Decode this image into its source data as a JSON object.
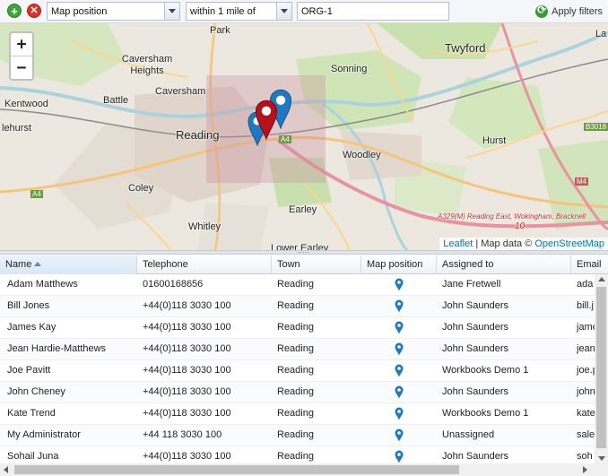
{
  "filter_bar": {
    "field_value": "Map position",
    "operator_value": "within 1 mile of",
    "target_value": "ORG-1",
    "apply_label": "Apply filters"
  },
  "map": {
    "zoom_in": "+",
    "zoom_out": "−",
    "labels": {
      "park": "Park",
      "caversham_heights": "Caversham Heights",
      "caversham": "Caversham",
      "battle": "Battle",
      "kentwood": "Kentwood",
      "tilehurst": "lehurst",
      "reading": "Reading",
      "coley": "Coley",
      "whitley": "Whitley",
      "earley": "Earley",
      "lower_earley": "Lower Earley",
      "sonning": "Sonning",
      "twyford": "Twyford",
      "woodley": "Woodley",
      "hurst": "Hurst",
      "a329m": "A329(M) Reading East, Wokingham, Bracknell",
      "junction_10": "10",
      "a4_centre": "A4",
      "a4_west": "A4",
      "m4": "M4",
      "b3018": "B3018",
      "la": "La"
    },
    "attribution_leaflet": "Leaflet",
    "attribution_sep": " | Map data © ",
    "attribution_osm": "OpenStreetMap",
    "colors": {
      "pin_blue": "#1e78c2",
      "pin_red": "#b5131c"
    }
  },
  "grid": {
    "columns": [
      "Name",
      "Telephone",
      "Town",
      "Map position",
      "Assigned to",
      "Email"
    ],
    "sorted_column": "Name",
    "rows": [
      {
        "name": "Adam Matthews",
        "telephone": "01600168656",
        "town": "Reading",
        "map_icon": "map-pin-icon",
        "assigned_to": "Jane Fretwell",
        "email": "ada"
      },
      {
        "name": "Bill Jones",
        "telephone": "+44(0)118 3030 100",
        "town": "Reading",
        "map_icon": "map-pin-icon",
        "assigned_to": "John Saunders",
        "email": "bill.j"
      },
      {
        "name": "James Kay",
        "telephone": "+44(0)118 3030 100",
        "town": "Reading",
        "map_icon": "map-pin-icon",
        "assigned_to": "John Saunders",
        "email": "jame"
      },
      {
        "name": "Jean Hardie-Matthews",
        "telephone": "+44(0)118 3030 100",
        "town": "Reading",
        "map_icon": "map-pin-icon",
        "assigned_to": "John Saunders",
        "email": "jean"
      },
      {
        "name": "Joe Pavitt",
        "telephone": "+44(0)118 3030 100",
        "town": "Reading",
        "map_icon": "map-pin-icon",
        "assigned_to": "Workbooks Demo 1",
        "email": "joe.p"
      },
      {
        "name": "John Cheney",
        "telephone": "+44(0)118 3030 100",
        "town": "Reading",
        "map_icon": "map-pin-icon",
        "assigned_to": "John Saunders",
        "email": "john"
      },
      {
        "name": "Kate Trend",
        "telephone": "+44(0)118 3030 100",
        "town": "Reading",
        "map_icon": "map-pin-icon",
        "assigned_to": "Workbooks Demo 1",
        "email": "kate"
      },
      {
        "name": "My Administrator",
        "telephone": "+44 118 3030 100",
        "town": "Reading",
        "map_icon": "map-pin-icon",
        "assigned_to": "Unassigned",
        "email": "sale"
      },
      {
        "name": "Sohail Juna",
        "telephone": "+44(0)118 3030 100",
        "town": "Reading",
        "map_icon": "map-pin-icon",
        "assigned_to": "John Saunders",
        "email": "soh"
      }
    ]
  }
}
